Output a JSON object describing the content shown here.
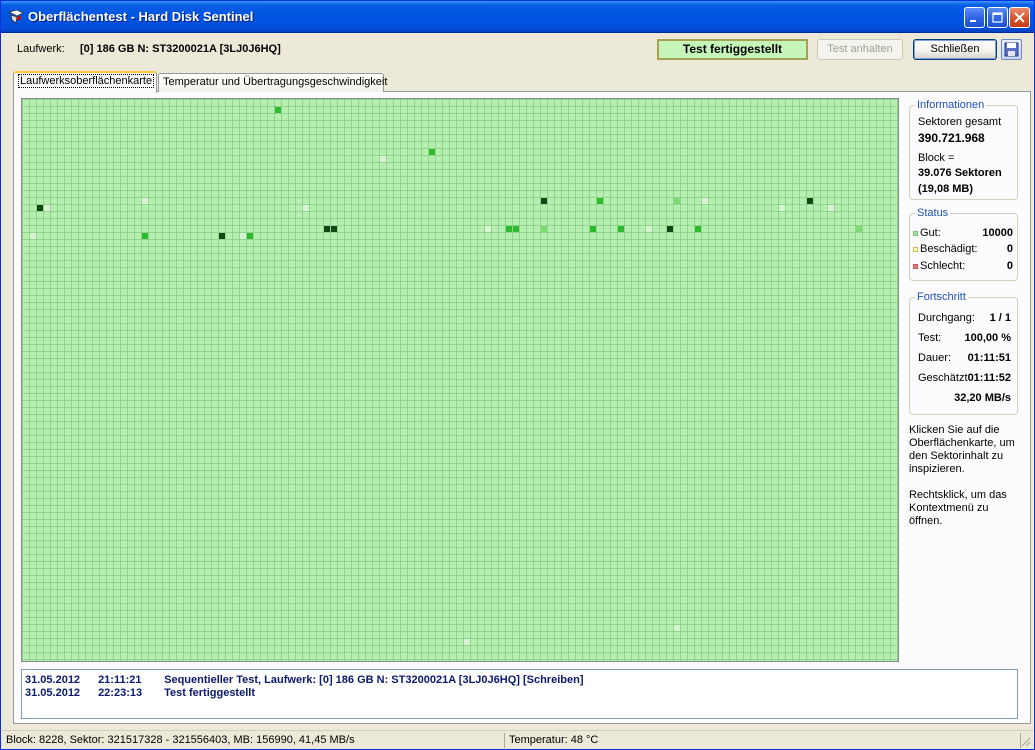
{
  "window": {
    "title": "Oberflächentest - Hard Disk Sentinel"
  },
  "drive": {
    "label": "Laufwerk:",
    "value": "[0] 186 GB N: ST3200021A [3LJ0J6HQ]"
  },
  "toolbar": {
    "status_text": "Test fertiggestellt",
    "pause_label": "Test anhalten",
    "close_label": "Schließen"
  },
  "tabs": [
    {
      "label": "Laufwerksoberflächenkarte",
      "active": true
    },
    {
      "label": "Temperatur und Übertragungsgeschwindigkeit",
      "active": false
    }
  ],
  "info": {
    "title": "Informationen",
    "sectors_label": "Sektoren gesamt",
    "sectors_value": "390.721.968",
    "block_label": "Block =",
    "block_value": "39.076 Sektoren",
    "block_mb": "(19,08 MB)"
  },
  "status": {
    "title": "Status",
    "items": [
      {
        "label": "Gut:",
        "value": "10000",
        "color": "#9fe09a"
      },
      {
        "label": "Beschädigt:",
        "value": "0",
        "color": "#f0e68c"
      },
      {
        "label": "Schlecht:",
        "value": "0",
        "color": "#e07b7b"
      }
    ]
  },
  "progress": {
    "title": "Fortschritt",
    "pass_label": "Durchgang:",
    "pass_value": "1 / 1",
    "test_label": "Test:",
    "test_value": "100,00 %",
    "duration_label": "Dauer:",
    "duration_value": "01:11:51",
    "estimated_label": "Geschätzt:",
    "estimated_value": "01:11:52",
    "speed_value": "32,20 MB/s"
  },
  "hints": {
    "click_hint": "Klicken Sie auf die Oberflächenkarte, um den Sektorinhalt zu inspizieren.",
    "right_click_hint": "Rechtsklick, um das Kontextmenü zu öffnen."
  },
  "log": [
    {
      "date": "31.05.2012",
      "time": "21:11:21",
      "message": "Sequentieller Test, Laufwerk: [0] 186 GB N: ST3200021A [3LJ0J6HQ] [Schreiben]"
    },
    {
      "date": "31.05.2012",
      "time": "22:23:13",
      "message": "Test fertiggestellt"
    }
  ],
  "statusbar": {
    "block_info": "Block: 8228, Sektor: 321517328 - 321556403, MB: 156990, 41,45 MB/s",
    "temperature": "Temperatur: 48  °C"
  },
  "surface_map": {
    "grid_columns": 125,
    "grid_rows": 80,
    "colors": {
      "good": "#b6f0b0",
      "light": "#d6f3d2",
      "medium": "#7ddb76",
      "strong": "#2dbb2d",
      "dark": "#0f4a14"
    },
    "marked_blocks": [
      {
        "col": 36,
        "row": 1,
        "shade": "strong"
      },
      {
        "col": 58,
        "row": 7,
        "shade": "strong"
      },
      {
        "col": 51,
        "row": 8,
        "shade": "light"
      },
      {
        "col": 2,
        "row": 15,
        "shade": "dark"
      },
      {
        "col": 3,
        "row": 15,
        "shade": "light"
      },
      {
        "col": 17,
        "row": 14,
        "shade": "light"
      },
      {
        "col": 40,
        "row": 15,
        "shade": "light"
      },
      {
        "col": 74,
        "row": 14,
        "shade": "dark"
      },
      {
        "col": 82,
        "row": 14,
        "shade": "strong"
      },
      {
        "col": 93,
        "row": 14,
        "shade": "medium"
      },
      {
        "col": 97,
        "row": 14,
        "shade": "light"
      },
      {
        "col": 108,
        "row": 15,
        "shade": "light"
      },
      {
        "col": 112,
        "row": 14,
        "shade": "dark"
      },
      {
        "col": 115,
        "row": 15,
        "shade": "light"
      },
      {
        "col": 1,
        "row": 19,
        "shade": "light"
      },
      {
        "col": 17,
        "row": 19,
        "shade": "strong"
      },
      {
        "col": 28,
        "row": 19,
        "shade": "dark"
      },
      {
        "col": 31,
        "row": 19,
        "shade": "light"
      },
      {
        "col": 32,
        "row": 19,
        "shade": "strong"
      },
      {
        "col": 43,
        "row": 18,
        "shade": "dark"
      },
      {
        "col": 44,
        "row": 18,
        "shade": "dark"
      },
      {
        "col": 66,
        "row": 18,
        "shade": "light"
      },
      {
        "col": 69,
        "row": 18,
        "shade": "strong"
      },
      {
        "col": 70,
        "row": 18,
        "shade": "strong"
      },
      {
        "col": 74,
        "row": 18,
        "shade": "medium"
      },
      {
        "col": 81,
        "row": 18,
        "shade": "strong"
      },
      {
        "col": 85,
        "row": 18,
        "shade": "strong"
      },
      {
        "col": 89,
        "row": 18,
        "shade": "light"
      },
      {
        "col": 92,
        "row": 18,
        "shade": "dark"
      },
      {
        "col": 96,
        "row": 18,
        "shade": "strong"
      },
      {
        "col": 119,
        "row": 18,
        "shade": "medium"
      },
      {
        "col": 63,
        "row": 77,
        "shade": "light"
      },
      {
        "col": 93,
        "row": 75,
        "shade": "light"
      }
    ]
  }
}
